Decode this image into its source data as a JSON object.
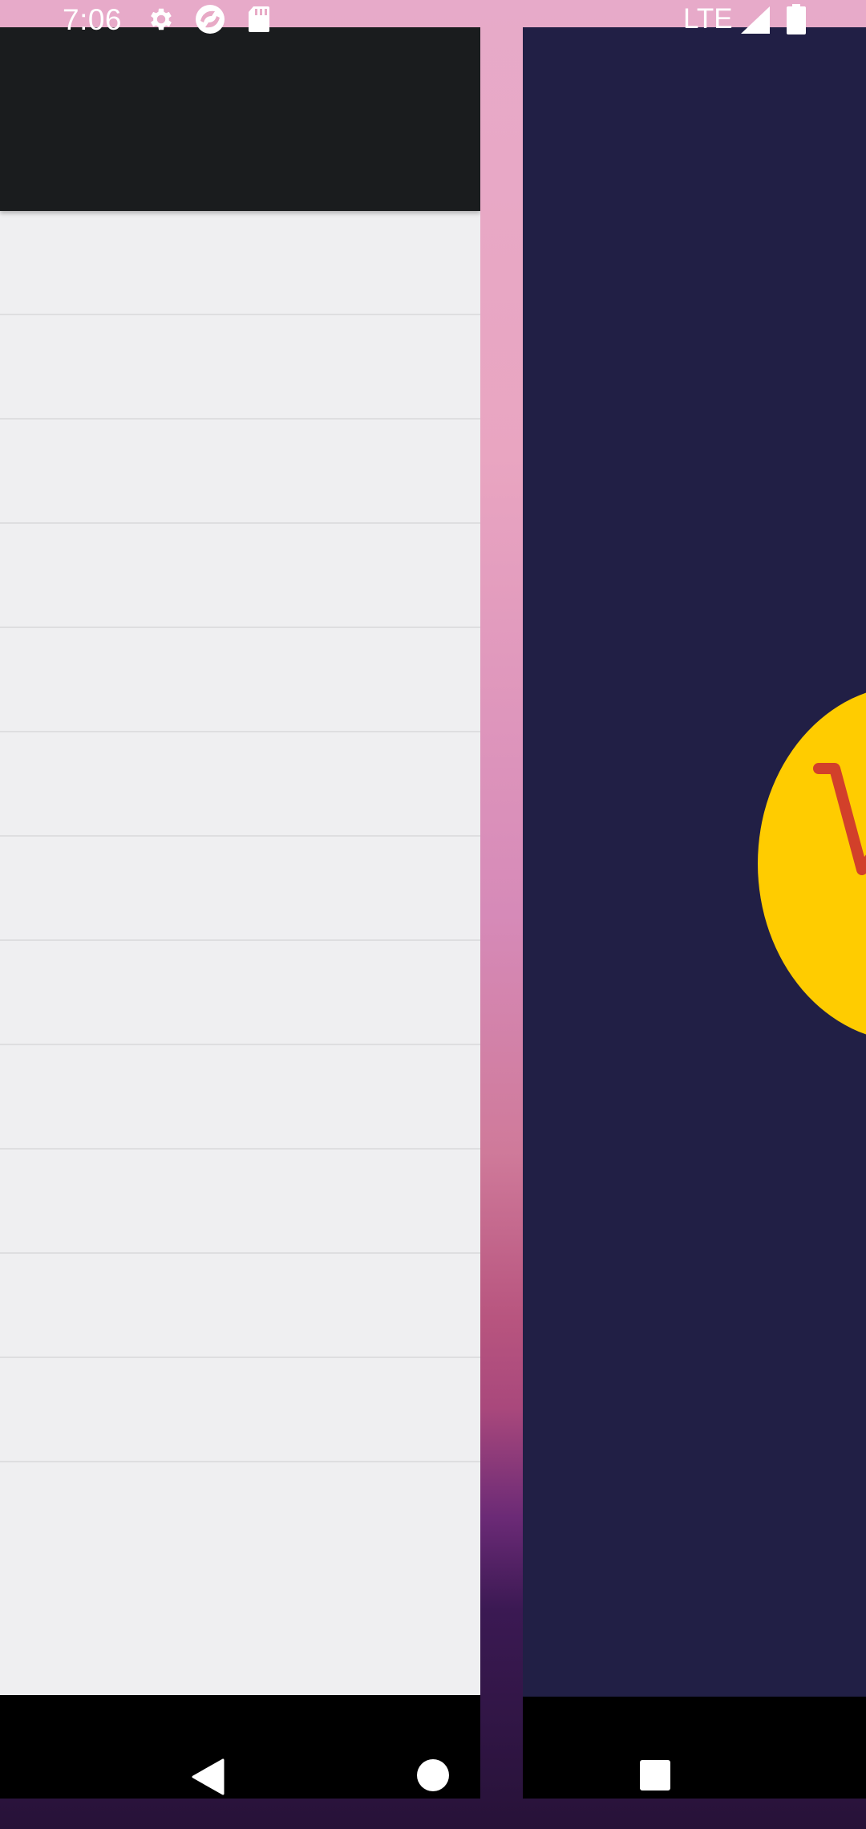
{
  "status_bar": {
    "time": "7:06",
    "network": "LTE",
    "icons": [
      "settings-icon",
      "sync-icon",
      "sd-card-icon",
      "signal-icon",
      "battery-icon"
    ]
  },
  "recents": {
    "left_app": {
      "toolbar_color": "#1a1c1e",
      "background_color": "#efeff1",
      "row_count": 12
    },
    "right_app": {
      "background_color": "#211f45",
      "logo_color": "#ffcc00",
      "logo_mark_color": "#d2402a",
      "logo_icon": "shopping-cart-icon"
    }
  },
  "nav_bar": {
    "buttons": [
      "back-icon",
      "home-icon",
      "recents-icon"
    ]
  },
  "colors": {
    "wallpaper_top": "#e7aac9",
    "wallpaper_bottom": "#271238"
  }
}
